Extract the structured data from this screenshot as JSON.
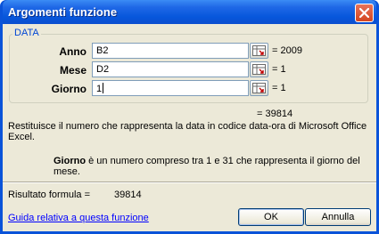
{
  "window": {
    "title": "Argomenti funzione"
  },
  "group": {
    "label": "DATA",
    "args": [
      {
        "name": "Anno",
        "input": "B2",
        "value": "= 2009"
      },
      {
        "name": "Mese",
        "input": "D2",
        "value": "= 1"
      },
      {
        "name": "Giorno",
        "input": "1",
        "value": "= 1"
      }
    ]
  },
  "result_inline": "= 39814",
  "description": "Restituisce il numero che rappresenta la data in codice data-ora di Microsoft Office Excel.",
  "arg_description": {
    "name": "Giorno",
    "text": " è un numero compreso tra 1 e 31 che rappresenta il giorno del mese."
  },
  "formula": {
    "label": "Risultato formula =",
    "value": "39814"
  },
  "help_link": "Guida relativa a questa funzione",
  "buttons": {
    "ok": "OK",
    "cancel": "Annulla"
  },
  "colors": {
    "titlebar": "#0a53d9",
    "client": "#ece9d8",
    "group_label": "#0046d5",
    "link": "#0000ff",
    "close": "#d4451f"
  }
}
